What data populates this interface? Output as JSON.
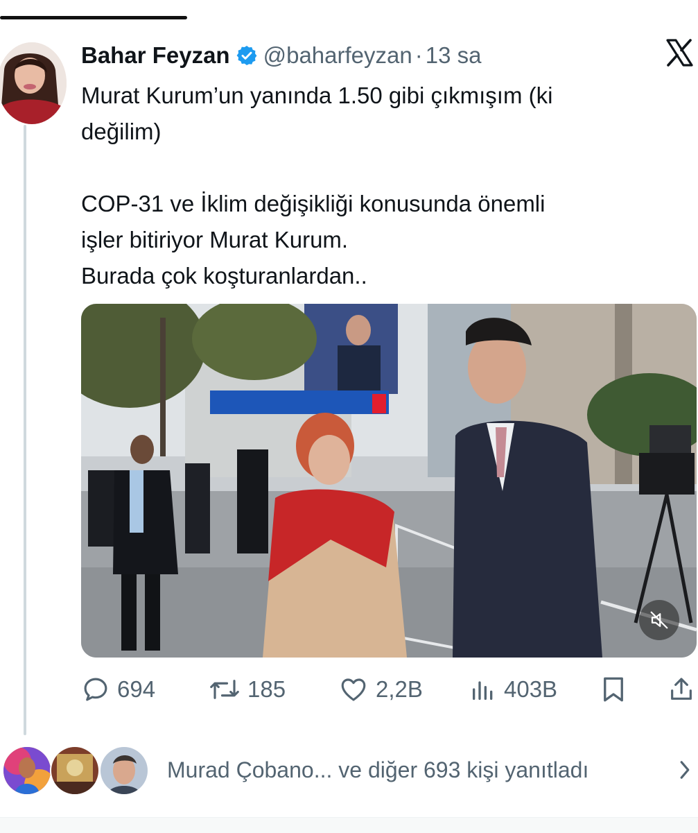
{
  "tweet": {
    "author_name": "Bahar Feyzan",
    "handle": "@baharfeyzan",
    "separator": "·",
    "time": "13 sa",
    "verified": true,
    "lines": [
      "Murat Kurum’un yanında 1.50 gibi çıkmışım (ki",
      "değilim)",
      "",
      "COP-31 ve İklim değişikliği konusunda önemli",
      "işler bitiriyor Murat Kurum.",
      "Burada çok koşturanlardan.."
    ]
  },
  "actions": {
    "replies": "694",
    "retweets": "185",
    "likes": "2,2B",
    "views": "403B"
  },
  "replies_summary": {
    "text": "Murad Çobano... ve diğer 693 kişi yanıtladı"
  },
  "icons": {
    "platform_logo": "x-logo",
    "verified": "verified-badge-icon",
    "reply": "reply-icon",
    "retweet": "retweet-icon",
    "like": "heart-icon",
    "views": "views-icon",
    "bookmark": "bookmark-icon",
    "share": "share-icon",
    "mute": "mute-icon",
    "chevron": "chevron-right-icon"
  },
  "colors": {
    "accent": "#1d9bf0",
    "text_primary": "#0f1419",
    "text_secondary": "#536471"
  }
}
